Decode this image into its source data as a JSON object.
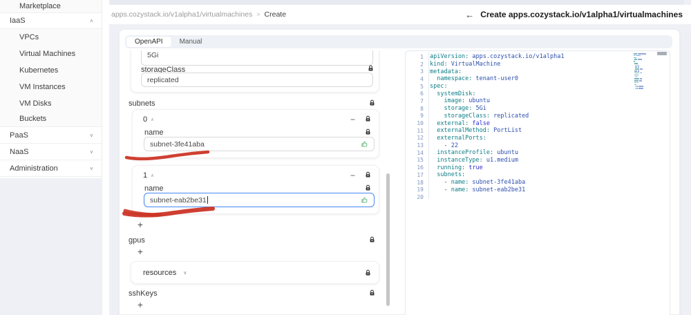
{
  "sidebar": {
    "items": [
      {
        "label": "Marketplace",
        "level": "sub",
        "chevron": ""
      },
      {
        "label": "IaaS",
        "level": "top",
        "chevron": "∧"
      },
      {
        "label": "VPCs",
        "level": "sub",
        "chevron": ""
      },
      {
        "label": "Virtual Machines",
        "level": "sub",
        "chevron": ""
      },
      {
        "label": "Kubernetes",
        "level": "sub",
        "chevron": ""
      },
      {
        "label": "VM Instances",
        "level": "sub",
        "chevron": ""
      },
      {
        "label": "VM Disks",
        "level": "sub",
        "chevron": ""
      },
      {
        "label": "Buckets",
        "level": "sub",
        "chevron": ""
      },
      {
        "label": "PaaS",
        "level": "top",
        "chevron": "∨"
      },
      {
        "label": "NaaS",
        "level": "top",
        "chevron": "∨"
      },
      {
        "label": "Administration",
        "level": "top",
        "chevron": "∨"
      }
    ]
  },
  "breadcrumb": {
    "path": "apps.cozystack.io/v1alpha1/virtualmachines",
    "separator": ">",
    "current": "Create"
  },
  "header": {
    "back_icon": "←",
    "title": "Create apps.cozystack.io/v1alpha1/virtualmachines"
  },
  "tabs": {
    "openapi": "OpenAPI",
    "manual": "Manual"
  },
  "form": {
    "storage_size_value": "5Gi",
    "storage_class": {
      "label": "storageClass",
      "value": "replicated"
    },
    "subnets": {
      "label": "subnets",
      "collapse_icon": "∧",
      "remove_icon": "−",
      "add_icon": "+",
      "items": [
        {
          "index": "0",
          "name_label": "name",
          "value": "subnet-3fe41aba"
        },
        {
          "index": "1",
          "name_label": "name",
          "value": "subnet-eab2be31"
        }
      ]
    },
    "gpus": {
      "label": "gpus",
      "add_icon": "+"
    },
    "resources": {
      "label": "resources",
      "expand_icon": "∨"
    },
    "ssh_keys": {
      "label": "sshKeys",
      "add_icon": "+"
    }
  },
  "editor": {
    "lines": [
      {
        "n": 1,
        "t": [
          [
            "k",
            "apiVersion:"
          ],
          [
            "v",
            " apps.cozystack.io/v1alpha1"
          ]
        ]
      },
      {
        "n": 2,
        "t": [
          [
            "k",
            "kind:"
          ],
          [
            "v",
            " VirtualMachine"
          ]
        ]
      },
      {
        "n": 3,
        "t": [
          [
            "k",
            "metadata:"
          ]
        ]
      },
      {
        "n": 4,
        "t": [
          [
            "k",
            "  namespace:"
          ],
          [
            "v",
            " tenant-user0"
          ]
        ]
      },
      {
        "n": 5,
        "t": [
          [
            "k",
            "spec:"
          ]
        ]
      },
      {
        "n": 6,
        "t": [
          [
            "k",
            "  systemDisk:"
          ]
        ]
      },
      {
        "n": 7,
        "t": [
          [
            "k",
            "    image:"
          ],
          [
            "v",
            " ubuntu"
          ]
        ]
      },
      {
        "n": 8,
        "t": [
          [
            "k",
            "    storage:"
          ],
          [
            "v",
            " 5Gi"
          ]
        ]
      },
      {
        "n": 9,
        "t": [
          [
            "k",
            "    storageClass:"
          ],
          [
            "v",
            " replicated"
          ]
        ]
      },
      {
        "n": 10,
        "t": [
          [
            "k",
            "  external:"
          ],
          [
            "b",
            " false"
          ]
        ]
      },
      {
        "n": 11,
        "t": [
          [
            "k",
            "  externalMethod:"
          ],
          [
            "v",
            " PortList"
          ]
        ]
      },
      {
        "n": 12,
        "t": [
          [
            "k",
            "  externalPorts:"
          ]
        ]
      },
      {
        "n": 13,
        "t": [
          [
            "p",
            "    - "
          ],
          [
            "v",
            "22"
          ]
        ]
      },
      {
        "n": 14,
        "t": [
          [
            "k",
            "  instanceProfile:"
          ],
          [
            "v",
            " ubuntu"
          ]
        ]
      },
      {
        "n": 15,
        "t": [
          [
            "k",
            "  instanceType:"
          ],
          [
            "v",
            " u1.medium"
          ]
        ]
      },
      {
        "n": 16,
        "t": [
          [
            "k",
            "  running:"
          ],
          [
            "b",
            " true"
          ]
        ]
      },
      {
        "n": 17,
        "t": [
          [
            "k",
            "  subnets:"
          ]
        ]
      },
      {
        "n": 18,
        "t": [
          [
            "p",
            "    - "
          ],
          [
            "k",
            "name:"
          ],
          [
            "v",
            " subnet-3fe41aba"
          ]
        ]
      },
      {
        "n": 19,
        "t": [
          [
            "p",
            "    - "
          ],
          [
            "k",
            "name:"
          ],
          [
            "v",
            " subnet-eab2be31"
          ]
        ]
      },
      {
        "n": 20,
        "t": []
      }
    ]
  },
  "colors": {
    "focus_blue": "#4387f4",
    "annotation_red": "#cc3526",
    "thumb_green": "#5fb878",
    "key_teal": "#0e7d86",
    "value_blue": "#2d4fae"
  }
}
